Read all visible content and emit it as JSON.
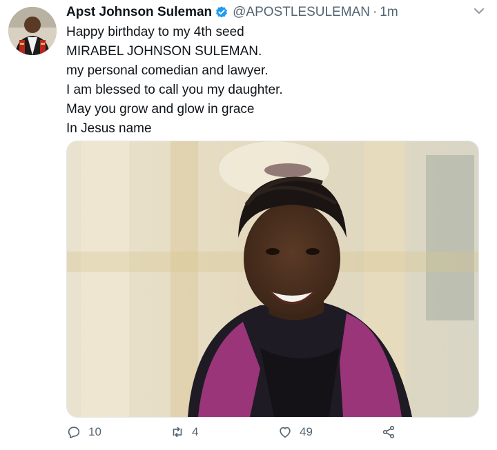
{
  "tweet": {
    "display_name": "Apst Johnson Suleman",
    "handle": "@APOSTLESULEMAN",
    "separator": "·",
    "time": "1m",
    "lines": [
      "Happy birthday to my 4th seed",
      "MIRABEL JOHNSON SULEMAN.",
      "my personal comedian and lawyer.",
      "I am blessed to call you my daughter.",
      "May you grow and glow in grace",
      "In Jesus name"
    ]
  },
  "actions": {
    "reply_count": "10",
    "retweet_count": "4",
    "like_count": "49"
  },
  "colors": {
    "text": "#0f1419",
    "secondary": "#536471",
    "verified": "#1d9bf0"
  },
  "icons": {
    "verified": "verified-badge-icon",
    "more": "chevron-down-icon",
    "reply": "reply-icon",
    "retweet": "retweet-icon",
    "like": "heart-icon",
    "share": "share-icon"
  }
}
